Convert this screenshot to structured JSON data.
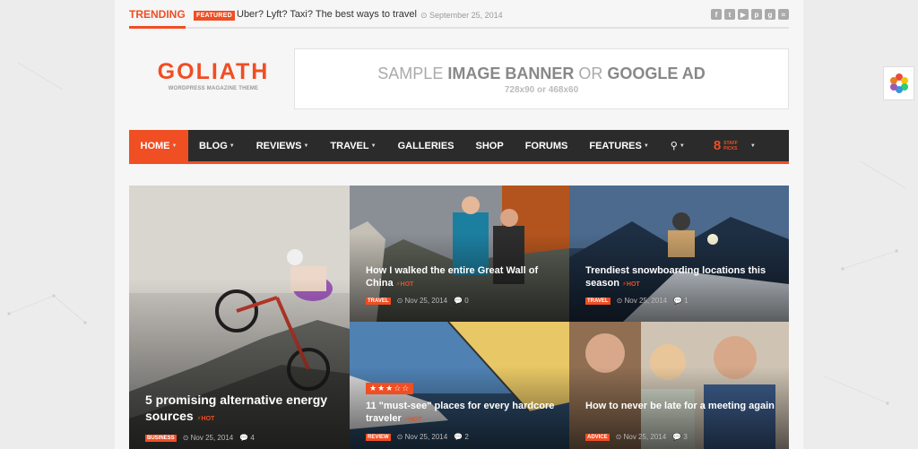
{
  "topbar": {
    "trending_label": "TRENDING",
    "featured_badge": "FEATURED",
    "headline": "Uber? Lyft? Taxi? The best ways to travel",
    "date": "September 25, 2014",
    "social_icons": [
      "facebook-icon",
      "twitter-icon",
      "youtube-icon",
      "pinterest-icon",
      "google-plus-icon",
      "rss-icon"
    ]
  },
  "logo": {
    "name": "GOLIATH",
    "tagline": "WORDPRESS MAGAZINE THEME"
  },
  "banner": {
    "title_light_1": "SAMPLE ",
    "title_bold_1": "IMAGE BANNER",
    "title_light_2": " OR ",
    "title_bold_2": "GOOGLE AD",
    "subtitle": "728x90 or 468x60"
  },
  "nav": {
    "items": [
      {
        "label": "HOME",
        "dropdown": true
      },
      {
        "label": "BLOG",
        "dropdown": true
      },
      {
        "label": "REVIEWS",
        "dropdown": true
      },
      {
        "label": "TRAVEL",
        "dropdown": true
      },
      {
        "label": "GALLERIES",
        "dropdown": false
      },
      {
        "label": "SHOP",
        "dropdown": false
      },
      {
        "label": "FORUMS",
        "dropdown": false
      },
      {
        "label": "FEATURES",
        "dropdown": true
      }
    ],
    "staff_picks_count": "8",
    "staff_picks_label_1": "STAFF",
    "staff_picks_label_2": "PICKS"
  },
  "posts": [
    {
      "title": "5 promising alternative energy sources",
      "hot": "HOT",
      "category": "BUSINESS",
      "date": "Nov 25, 2014",
      "comments": "4"
    },
    {
      "title": "How I walked the entire Great Wall of China",
      "hot": "HOT",
      "category": "TRAVEL",
      "date": "Nov 25, 2014",
      "comments": "0"
    },
    {
      "title": "Trendiest snowboarding locations this season",
      "hot": "HOT",
      "category": "TRAVEL",
      "date": "Nov 25, 2014",
      "comments": "1"
    },
    {
      "title": "11 \"must-see\" places for every hardcore traveler",
      "hot": "HOT",
      "category": "REVIEW",
      "date": "Nov 25, 2014",
      "comments": "2",
      "rating": "★★★☆☆"
    },
    {
      "title": "How to never be late for a meeting again",
      "hot": "",
      "category": "ADVICE",
      "date": "Nov 25, 2014",
      "comments": "3"
    }
  ],
  "colors": {
    "accent": "#f04e23",
    "nav_bg": "#2b2b2b"
  }
}
